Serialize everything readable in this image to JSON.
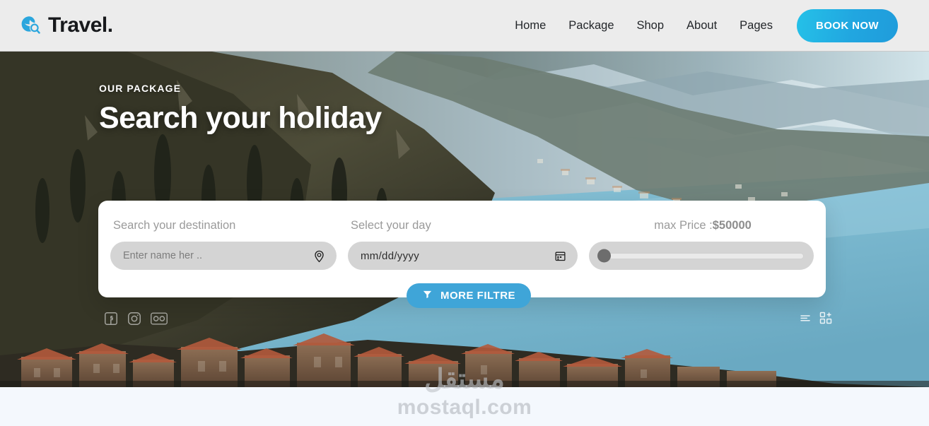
{
  "header": {
    "logo_icon": "globe-search-icon",
    "brand": "Travel.",
    "nav": [
      {
        "label": "Home"
      },
      {
        "label": "Package"
      },
      {
        "label": "Shop"
      },
      {
        "label": "About"
      },
      {
        "label": "Pages"
      }
    ],
    "cta": {
      "label": "BOOK NOW",
      "color": "#21a6e0"
    }
  },
  "hero": {
    "kicker": "OUR PACKAGE",
    "headline": "Search your holiday",
    "image_description": "Aerial view of a lakeside town with forested hillside and blue lake"
  },
  "search": {
    "destination": {
      "label": "Search your destination",
      "placeholder": "Enter name her ..",
      "value": "",
      "icon": "location-pin-icon"
    },
    "date": {
      "label": "Select your day",
      "value": "mm/dd/yyyy",
      "icon": "calendar-icon"
    },
    "price": {
      "label": "max Price :",
      "value": "$50000",
      "slider_position_percent": 0
    },
    "more_filtre": {
      "label": "MORE FILTRE",
      "icon": "filter-funnel-icon",
      "color": "#3fa5d8"
    }
  },
  "overlay": {
    "social": [
      {
        "icon": "facebook-icon"
      },
      {
        "icon": "instagram-icon"
      },
      {
        "icon": "flickr-icon"
      }
    ],
    "right": [
      {
        "icon": "menu-lines-icon"
      },
      {
        "icon": "grid-add-icon"
      }
    ]
  },
  "watermark": {
    "arabic": "مستقل",
    "latin": "mostaql.com"
  }
}
